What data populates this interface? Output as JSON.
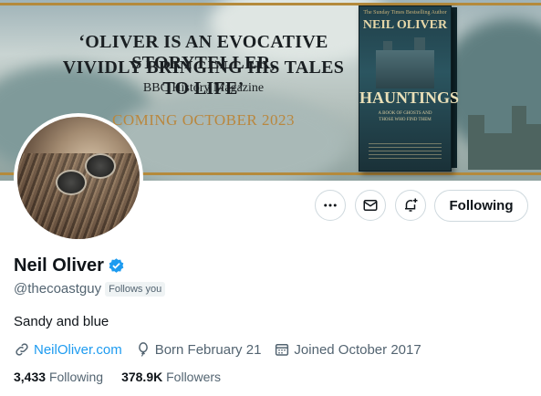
{
  "banner": {
    "quote_line1": "‘OLIVER IS AN EVOCATIVE STORYTELLER,",
    "quote_line2": "VIVIDLY BRINGING HIS TALES TO LIFE’",
    "quote_source": "BBC History Magazine",
    "announcement": "COMING OCTOBER 2023",
    "book": {
      "tagline": "The Sunday Times Bestselling Author",
      "author": "NEIL OLIVER",
      "title": "HAUNTINGS",
      "subtitle": "A BOOK OF GHOSTS AND THOSE WHO FIND THEM"
    },
    "colors": {
      "gold": "#b9873e",
      "sky": "#c9d4d2"
    }
  },
  "actions": {
    "more_icon": "more-horizontal-icon",
    "message_icon": "envelope-icon",
    "notify_icon": "bell-plus-icon",
    "follow_label": "Following"
  },
  "profile": {
    "name": "Neil Oliver",
    "verified_icon": "verified-badge-icon",
    "handle": "@thecoastguy",
    "follows_you": "Follows you",
    "bio": "Sandy and blue",
    "website": "NeilOliver.com",
    "born": "Born February 21",
    "joined": "Joined October 2017"
  },
  "stats": {
    "following_count": "3,433",
    "following_label": "Following",
    "followers_count": "378.9K",
    "followers_label": "Followers"
  },
  "colors": {
    "accent": "#1d9bf0",
    "muted": "#536471",
    "text": "#0f1419"
  }
}
